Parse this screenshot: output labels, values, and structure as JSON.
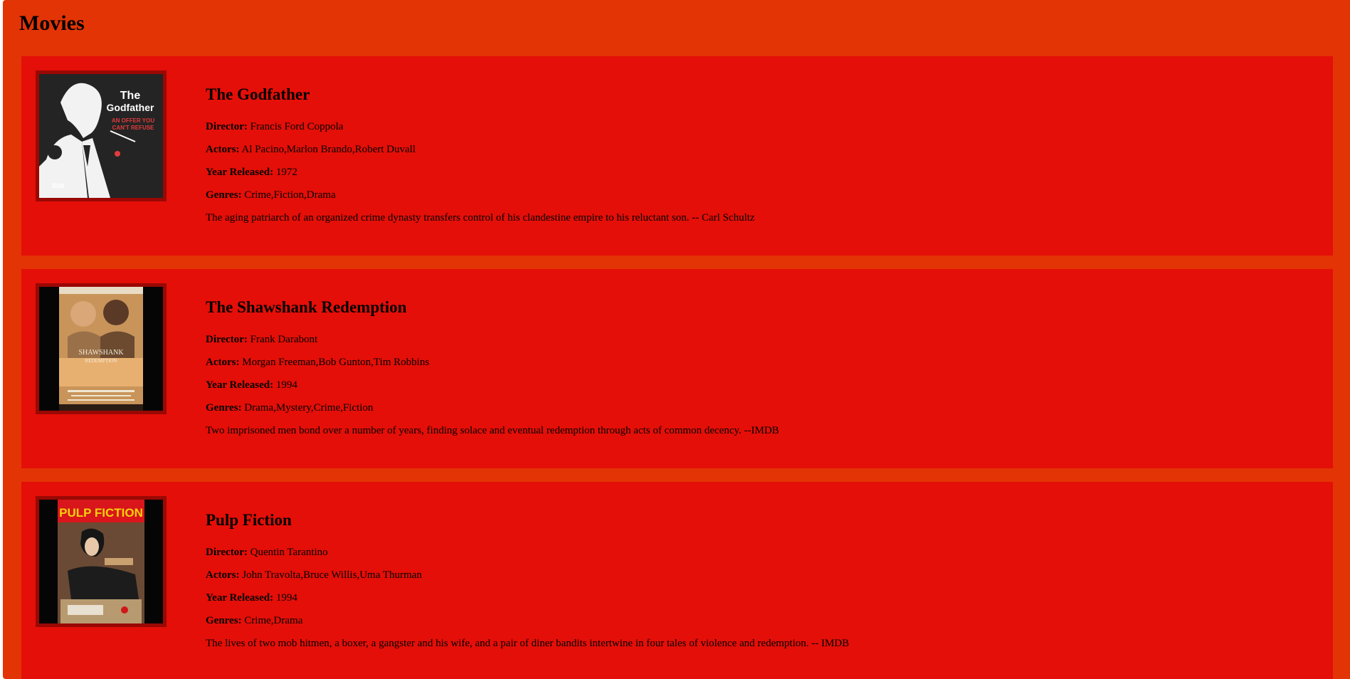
{
  "page": {
    "title": "Movies"
  },
  "labels": {
    "director": "Director:",
    "actors": "Actors:",
    "year": "Year Released:",
    "genres": "Genres:"
  },
  "movies": [
    {
      "title": "The Godfather",
      "director": "Francis Ford Coppola",
      "actors": "Al Pacino,Marlon Brando,Robert Duvall",
      "year": "1972",
      "genres": "Crime,Fiction,Drama",
      "description": "The aging patriarch of an organized crime dynasty transfers control of his clandestine empire to his reluctant son. -- Carl Schultz",
      "poster": {
        "line1": "The",
        "line2": "Godfather",
        "tagline1": "AN OFFER YOU",
        "tagline2": "CAN'T REFUSE",
        "publisher": "IDW"
      }
    },
    {
      "title": "The Shawshank Redemption",
      "director": "Frank Darabont",
      "actors": "Morgan Freeman,Bob Gunton,Tim Robbins",
      "year": "1994",
      "genres": "Drama,Mystery,Crime,Fiction",
      "description": "Two imprisoned men bond over a number of years, finding solace and eventual redemption through acts of common decency. --IMDB",
      "poster": {
        "line1": "SHAWSHANK",
        "line2": "REDEMPTION"
      }
    },
    {
      "title": "Pulp Fiction",
      "director": "Quentin Tarantino",
      "actors": "John Travolta,Bruce Willis,Uma Thurman",
      "year": "1994",
      "genres": "Crime,Drama",
      "description": "The lives of two mob hitmen, a boxer, a gangster and his wife, and a pair of diner bandits intertwine in four tales of violence and redemption. -- IMDB",
      "poster": {
        "line1": "PULP FICTION"
      }
    }
  ],
  "colors": {
    "page_background": "#e33405",
    "card_background": "#e40f08",
    "poster_border": "#9a0804"
  }
}
